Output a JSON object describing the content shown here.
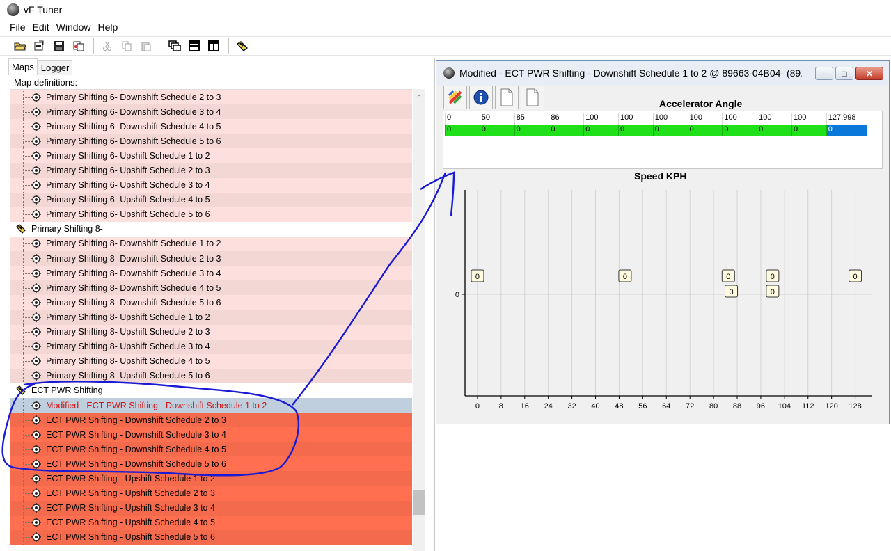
{
  "app": {
    "title": "vF Tuner"
  },
  "menu": [
    "File",
    "Edit",
    "Window",
    "Help"
  ],
  "toolbar": {
    "icons": [
      "open-folder-icon",
      "open-file-icon",
      "save-icon",
      "copy-file-icon",
      "cut-icon",
      "copy-icon",
      "paste-icon",
      "cascade-icon",
      "tile-horizontal-icon",
      "tile-vertical-icon",
      "tag-icon"
    ]
  },
  "left": {
    "tabs": [
      "Maps",
      "Logger"
    ],
    "map_definitions_label": "Map definitions:",
    "rows": [
      {
        "label": "Primary Shifting 6- Downshift Schedule 2 to 3",
        "kind": "pink"
      },
      {
        "label": "Primary Shifting 6- Downshift Schedule 3 to 4",
        "kind": "pink"
      },
      {
        "label": "Primary Shifting 6- Downshift Schedule 4 to 5",
        "kind": "pink"
      },
      {
        "label": "Primary Shifting 6- Downshift Schedule 5 to 6",
        "kind": "pink"
      },
      {
        "label": "Primary Shifting 6- Upshift Schedule 1 to 2",
        "kind": "pink"
      },
      {
        "label": "Primary Shifting 6- Upshift Schedule 2 to 3",
        "kind": "pink"
      },
      {
        "label": "Primary Shifting 6- Upshift Schedule 3 to 4",
        "kind": "pink"
      },
      {
        "label": "Primary Shifting 6- Upshift Schedule 4 to 5",
        "kind": "pink"
      },
      {
        "label": "Primary Shifting 6- Upshift Schedule 5 to 6",
        "kind": "pink"
      },
      {
        "label": "Primary Shifting 8-",
        "kind": "group"
      },
      {
        "label": "Primary Shifting 8- Downshift Schedule 1 to 2",
        "kind": "pink"
      },
      {
        "label": "Primary Shifting 8- Downshift Schedule 2 to 3",
        "kind": "pink"
      },
      {
        "label": "Primary Shifting 8- Downshift Schedule 3 to 4",
        "kind": "pink"
      },
      {
        "label": "Primary Shifting 8- Downshift Schedule 4 to 5",
        "kind": "pink"
      },
      {
        "label": "Primary Shifting 8- Downshift Schedule 5 to 6",
        "kind": "pink"
      },
      {
        "label": "Primary Shifting 8- Upshift Schedule 1 to 2",
        "kind": "pink"
      },
      {
        "label": "Primary Shifting 8- Upshift Schedule 2 to 3",
        "kind": "pink"
      },
      {
        "label": "Primary Shifting 8- Upshift Schedule 3 to 4",
        "kind": "pink"
      },
      {
        "label": "Primary Shifting 8- Upshift Schedule 4 to 5",
        "kind": "pink"
      },
      {
        "label": "Primary Shifting 8- Upshift Schedule 5 to 6",
        "kind": "pink"
      },
      {
        "label": "ECT PWR Shifting",
        "kind": "group"
      },
      {
        "label": "Modified - ECT PWR Shifting - Downshift Schedule 1 to 2",
        "kind": "sel"
      },
      {
        "label": "ECT PWR Shifting - Downshift Schedule 2 to 3",
        "kind": "red"
      },
      {
        "label": "ECT PWR Shifting - Downshift Schedule 3 to 4",
        "kind": "red"
      },
      {
        "label": "ECT PWR Shifting - Downshift Schedule 4 to 5",
        "kind": "red"
      },
      {
        "label": "ECT PWR Shifting - Downshift Schedule 5 to 6",
        "kind": "red"
      },
      {
        "label": "ECT PWR Shifting - Upshift Schedule 1 to 2",
        "kind": "red"
      },
      {
        "label": "ECT PWR Shifting - Upshift Schedule 2 to 3",
        "kind": "red"
      },
      {
        "label": "ECT PWR Shifting - Upshift Schedule 3 to 4",
        "kind": "red"
      },
      {
        "label": "ECT PWR Shifting - Upshift Schedule 4 to 5",
        "kind": "red"
      },
      {
        "label": "ECT PWR Shifting - Upshift Schedule 5 to 6",
        "kind": "red"
      }
    ]
  },
  "child": {
    "title": "Modified - ECT PWR Shifting - Downshift Schedule 1 to 2 @ 89663-04B04- (89...",
    "accel_label": "Accelerator Angle",
    "headers": [
      "0",
      "50",
      "85",
      "86",
      "100",
      "100",
      "100",
      "100",
      "100",
      "100",
      "100",
      "127.998"
    ],
    "values": [
      "0",
      "0",
      "0",
      "0",
      "0",
      "0",
      "0",
      "0",
      "0",
      "0",
      "0",
      "0"
    ],
    "speed_label": "Speed KPH"
  },
  "chart_data": {
    "type": "scatter",
    "title": "Speed KPH",
    "x_ticks": [
      "0",
      "8",
      "16",
      "24",
      "32",
      "40",
      "48",
      "56",
      "64",
      "72",
      "80",
      "88",
      "96",
      "104",
      "112",
      "120",
      "128"
    ],
    "y_ticks": [
      "0"
    ],
    "xlim": [
      -4,
      134
    ],
    "points": [
      {
        "x": 0,
        "y": 0,
        "label": "0",
        "row": "upper"
      },
      {
        "x": 50,
        "y": 0,
        "label": "0",
        "row": "upper"
      },
      {
        "x": 85,
        "y": 0,
        "label": "0",
        "row": "upper"
      },
      {
        "x": 86,
        "y": 0,
        "label": "0",
        "row": "lower"
      },
      {
        "x": 100,
        "y": 0,
        "label": "0",
        "row": "upper"
      },
      {
        "x": 100,
        "y": 0,
        "label": "0",
        "row": "lower"
      },
      {
        "x": 127.998,
        "y": 0,
        "label": "0",
        "row": "upper"
      }
    ],
    "grid": true
  },
  "colors": {
    "pink_row": "#fde0dd",
    "red_row": "#ff6f50",
    "selected_row": "#bfcfdd",
    "cell_green": "#20e01a",
    "cell_blue": "#0a78d8",
    "annotation_ink": "#1a1ad6"
  }
}
